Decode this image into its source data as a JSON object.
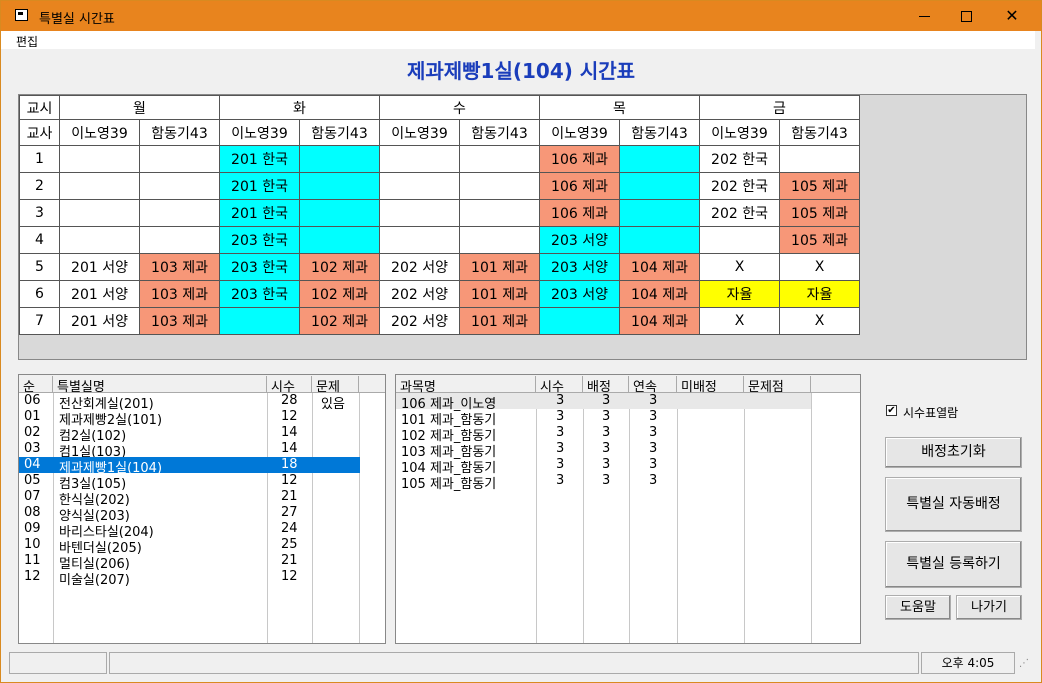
{
  "window": {
    "title": "특별실 시간표",
    "min_icon": "minimize-icon",
    "max_icon": "maximize-icon",
    "close_icon": "close-icon"
  },
  "menu": {
    "edit": "편집"
  },
  "heading": "제과제빵1실(104) 시간표",
  "timetable": {
    "corner_period": "교시",
    "corner_teacher": "교사",
    "days": [
      "월",
      "화",
      "수",
      "목",
      "금"
    ],
    "teachers": [
      "이노영39",
      "함동기43",
      "이노영39",
      "함동기43",
      "이노영39",
      "함동기43",
      "이노영39",
      "함동기43",
      "이노영39",
      "함동기43"
    ],
    "rows": [
      {
        "period": "1",
        "cells": [
          "",
          "",
          "201 한국",
          "",
          "",
          "",
          "106 제과",
          "",
          "202 한국",
          ""
        ]
      },
      {
        "period": "2",
        "cells": [
          "",
          "",
          "201 한국",
          "",
          "",
          "",
          "106 제과",
          "",
          "202 한국",
          "105 제과"
        ]
      },
      {
        "period": "3",
        "cells": [
          "",
          "",
          "201 한국",
          "",
          "",
          "",
          "106 제과",
          "",
          "202 한국",
          "105 제과"
        ]
      },
      {
        "period": "4",
        "cells": [
          "",
          "",
          "203 한국",
          "",
          "",
          "",
          "203 서양",
          "",
          "",
          "105 제과"
        ]
      },
      {
        "period": "5",
        "cells": [
          "201 서양",
          "103 제과",
          "203 한국",
          "102 제과",
          "202 서양",
          "101 제과",
          "203 서양",
          "104 제과",
          "X",
          "X"
        ]
      },
      {
        "period": "6",
        "cells": [
          "201 서양",
          "103 제과",
          "203 한국",
          "102 제과",
          "202 서양",
          "101 제과",
          "203 서양",
          "104 제과",
          "자율",
          "자율"
        ]
      },
      {
        "period": "7",
        "cells": [
          "201 서양",
          "103 제과",
          "",
          "102 제과",
          "202 서양",
          "101 제과",
          "",
          "104 제과",
          "X",
          "X"
        ]
      }
    ],
    "colors": [
      [
        "",
        "",
        "cyan",
        "cyan",
        "",
        "",
        "sal",
        "cyan",
        "",
        ""
      ],
      [
        "",
        "",
        "cyan",
        "cyan",
        "",
        "",
        "sal",
        "cyan",
        "",
        "sal"
      ],
      [
        "",
        "",
        "cyan",
        "cyan",
        "",
        "",
        "sal",
        "cyan",
        "",
        "sal"
      ],
      [
        "",
        "",
        "cyan",
        "cyan",
        "",
        "",
        "cyan",
        "cyan",
        "",
        "sal"
      ],
      [
        "",
        "sal",
        "cyan",
        "sal",
        "",
        "sal",
        "cyan",
        "sal",
        "",
        ""
      ],
      [
        "",
        "sal",
        "cyan",
        "sal",
        "",
        "sal",
        "cyan",
        "sal",
        "yel",
        "yel"
      ],
      [
        "",
        "sal",
        "cyan",
        "sal",
        "",
        "sal",
        "cyan",
        "sal",
        "",
        ""
      ]
    ]
  },
  "rooms": {
    "headers": [
      "순",
      "특별실명",
      "시수",
      "문제"
    ],
    "items": [
      {
        "no": "06",
        "name": "전산회계실(201)",
        "hours": "28",
        "issue": "있음"
      },
      {
        "no": "01",
        "name": "제과제빵2실(101)",
        "hours": "12",
        "issue": ""
      },
      {
        "no": "02",
        "name": "컴2실(102)",
        "hours": "14",
        "issue": ""
      },
      {
        "no": "03",
        "name": "컴1실(103)",
        "hours": "14",
        "issue": ""
      },
      {
        "no": "04",
        "name": "제과제빵1실(104)",
        "hours": "18",
        "issue": ""
      },
      {
        "no": "05",
        "name": "컴3실(105)",
        "hours": "12",
        "issue": ""
      },
      {
        "no": "07",
        "name": "한식실(202)",
        "hours": "21",
        "issue": ""
      },
      {
        "no": "08",
        "name": "양식실(203)",
        "hours": "27",
        "issue": ""
      },
      {
        "no": "09",
        "name": "바리스타실(204)",
        "hours": "24",
        "issue": ""
      },
      {
        "no": "10",
        "name": "바텐더실(205)",
        "hours": "25",
        "issue": ""
      },
      {
        "no": "11",
        "name": "멀티실(206)",
        "hours": "21",
        "issue": ""
      },
      {
        "no": "12",
        "name": "미술실(207)",
        "hours": "12",
        "issue": ""
      }
    ],
    "selected_index": 4
  },
  "subjects": {
    "headers": [
      "과목명",
      "시수",
      "배정",
      "연속",
      "미배정",
      "문제점"
    ],
    "items": [
      {
        "name": "106 제과_이노영",
        "hours": "3",
        "assigned": "3",
        "consecutive": "3"
      },
      {
        "name": "101 제과_함동기",
        "hours": "3",
        "assigned": "3",
        "consecutive": "3"
      },
      {
        "name": "102 제과_함동기",
        "hours": "3",
        "assigned": "3",
        "consecutive": "3"
      },
      {
        "name": "103 제과_함동기",
        "hours": "3",
        "assigned": "3",
        "consecutive": "3"
      },
      {
        "name": "104 제과_함동기",
        "hours": "3",
        "assigned": "3",
        "consecutive": "3"
      },
      {
        "name": "105 제과_함동기",
        "hours": "3",
        "assigned": "3",
        "consecutive": "3"
      }
    ]
  },
  "controls": {
    "checkbox_label": "시수표열람",
    "checkbox_checked": true,
    "reset_button": "배정초기화",
    "auto_assign_button": "특별실 자동배정",
    "register_button": "특별실 등록하기",
    "help_button": "도움말",
    "exit_button": "나가기"
  },
  "status": {
    "time": "오후 4:05"
  }
}
